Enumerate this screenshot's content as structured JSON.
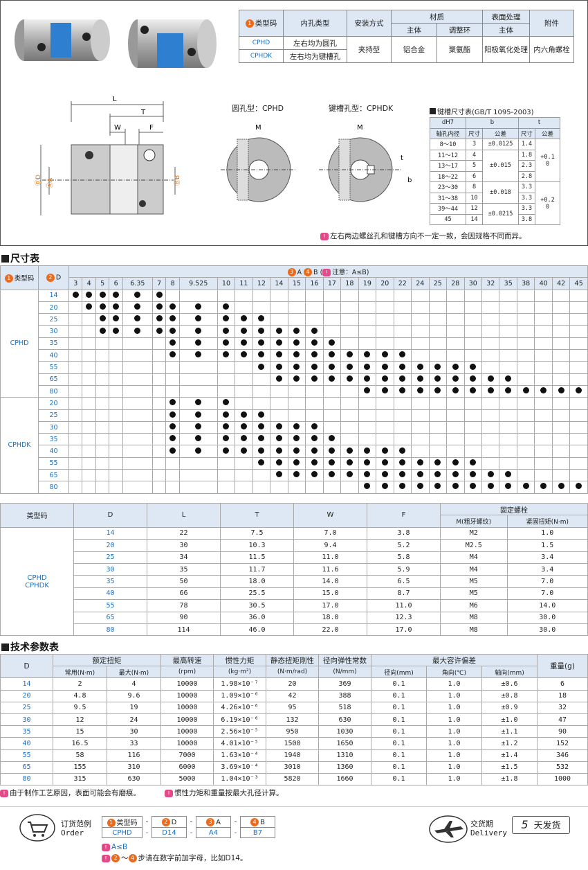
{
  "materials": {
    "headers": [
      "类型码",
      "内孔类型",
      "安装方式",
      "材质",
      "表面处理",
      "附件"
    ],
    "subheaders": [
      "主体",
      "调整环",
      "主体"
    ],
    "rows": [
      {
        "code": "CPHD",
        "hole": "左右均为圆孔"
      },
      {
        "code": "CPHDK",
        "hole": "左右均为键槽孔"
      }
    ],
    "mount": "夹持型",
    "body": "铝合金",
    "ring": "聚氨酯",
    "surface": "阳极氧化处理",
    "accessory": "内六角螺栓"
  },
  "drawing": {
    "round_title": "圆孔型：CPHD",
    "key_title": "键槽孔型：CPHDK",
    "L": "L",
    "T": "T",
    "W": "W",
    "F": "F",
    "M": "M",
    "t": "t",
    "b": "b",
    "D": "ⒹD",
    "A": "ⒶA",
    "B": "ⒷB"
  },
  "keyslot": {
    "title": "键槽尺寸表(GB/T 1095-2003)",
    "h1": "dH7",
    "h2": "轴孔内径",
    "b": "b",
    "t": "t",
    "size": "尺寸",
    "tol": "公差",
    "rows": [
      [
        "8～10",
        "3",
        "±0.0125",
        "1.4",
        "+0.1\n0"
      ],
      [
        "11～12",
        "4",
        "",
        "1.8",
        ""
      ],
      [
        "13～17",
        "5",
        "±0.015",
        "2.3",
        ""
      ],
      [
        "18～22",
        "6",
        "",
        "2.8",
        ""
      ],
      [
        "23～30",
        "8",
        "±0.018",
        "3.3",
        "+0.2\n0"
      ],
      [
        "31～38",
        "10",
        "",
        "3.3",
        ""
      ],
      [
        "39～44",
        "12",
        "±0.0215",
        "3.3",
        ""
      ],
      [
        "45",
        "14",
        "",
        "3.8",
        ""
      ]
    ]
  },
  "note_top": "左右两边螺丝孔和键槽方向不一定一致，会因规格不同而异。",
  "size_table": {
    "title": "尺寸表",
    "h_code": "类型码",
    "h_d": "D",
    "h_ab": "A",
    "h_b": "B",
    "h_note": "注意：A≤B",
    "cols": [
      "3",
      "4",
      "5",
      "6",
      "6.35",
      "7",
      "8",
      "9.525",
      "10",
      "11",
      "12",
      "14",
      "15",
      "16",
      "17",
      "18",
      "19",
      "20",
      "22",
      "24",
      "25",
      "28",
      "30",
      "32",
      "35",
      "38",
      "40",
      "42",
      "45"
    ],
    "groups": [
      {
        "code": "CPHD",
        "rows": [
          {
            "d": "14",
            "from": 0,
            "to": 5
          },
          {
            "d": "20",
            "from": 1,
            "to": 8
          },
          {
            "d": "25",
            "from": 2,
            "to": 10
          },
          {
            "d": "30",
            "from": 2,
            "to": 13
          },
          {
            "d": "35",
            "from": 6,
            "to": 14
          },
          {
            "d": "40",
            "from": 6,
            "to": 18
          },
          {
            "d": "55",
            "from": 10,
            "to": 22
          },
          {
            "d": "65",
            "from": 11,
            "to": 24
          },
          {
            "d": "80",
            "from": 16,
            "to": 28
          }
        ]
      },
      {
        "code": "CPHDK",
        "rows": [
          {
            "d": "20",
            "from": 6,
            "to": 8
          },
          {
            "d": "25",
            "from": 6,
            "to": 10
          },
          {
            "d": "30",
            "from": 6,
            "to": 13
          },
          {
            "d": "35",
            "from": 6,
            "to": 14
          },
          {
            "d": "40",
            "from": 6,
            "to": 18
          },
          {
            "d": "55",
            "from": 10,
            "to": 22
          },
          {
            "d": "65",
            "from": 11,
            "to": 24
          },
          {
            "d": "80",
            "from": 16,
            "to": 28
          }
        ]
      }
    ]
  },
  "dims": {
    "headers": [
      "类型码",
      "D",
      "L",
      "T",
      "W",
      "F",
      "固定螺栓"
    ],
    "sub": [
      "M(粗牙螺纹)",
      "紧固扭矩(N·m)"
    ],
    "codes": [
      "CPHD",
      "CPHDK"
    ],
    "rows": [
      [
        "14",
        "22",
        "7.5",
        "7.0",
        "3.8",
        "M2",
        "1.0"
      ],
      [
        "20",
        "30",
        "10.3",
        "9.4",
        "5.2",
        "M2.5",
        "1.5"
      ],
      [
        "25",
        "34",
        "11.5",
        "11.0",
        "5.8",
        "M4",
        "3.4"
      ],
      [
        "30",
        "35",
        "11.7",
        "11.6",
        "5.9",
        "M4",
        "3.4"
      ],
      [
        "35",
        "50",
        "18.0",
        "14.0",
        "6.5",
        "M5",
        "7.0"
      ],
      [
        "40",
        "66",
        "25.5",
        "15.0",
        "8.7",
        "M5",
        "7.0"
      ],
      [
        "55",
        "78",
        "30.5",
        "17.0",
        "11.0",
        "M6",
        "14.0"
      ],
      [
        "65",
        "90",
        "36.0",
        "18.0",
        "12.3",
        "M8",
        "30.0"
      ],
      [
        "80",
        "114",
        "46.0",
        "22.0",
        "17.0",
        "M8",
        "30.0"
      ]
    ]
  },
  "tech": {
    "title": "技术参数表",
    "headers": [
      "D",
      "额定扭矩",
      "最高转速",
      "惯性力矩",
      "静态扭矩刚性",
      "径向弹性常数",
      "最大容许偏差",
      "重量(g)"
    ],
    "sub": [
      "常用(N·m)",
      "最大(N·m)",
      "(rpm)",
      "(kg·m²)",
      "(N·m/rad)",
      "(N/mm)",
      "径向(mm)",
      "角向(℃)",
      "轴向(mm)"
    ],
    "rows": [
      [
        "14",
        "2",
        "4",
        "10000",
        "1.98×10⁻⁷",
        "20",
        "369",
        "0.1",
        "1.0",
        "±0.6",
        "6"
      ],
      [
        "20",
        "4.8",
        "9.6",
        "10000",
        "1.09×10⁻⁶",
        "42",
        "388",
        "0.1",
        "1.0",
        "±0.8",
        "18"
      ],
      [
        "25",
        "9.5",
        "19",
        "10000",
        "4.26×10⁻⁶",
        "95",
        "518",
        "0.1",
        "1.0",
        "±0.9",
        "32"
      ],
      [
        "30",
        "12",
        "24",
        "10000",
        "6.19×10⁻⁶",
        "132",
        "630",
        "0.1",
        "1.0",
        "±1.0",
        "47"
      ],
      [
        "35",
        "15",
        "30",
        "10000",
        "2.56×10⁻⁵",
        "950",
        "1030",
        "0.1",
        "1.0",
        "±1.1",
        "90"
      ],
      [
        "40",
        "16.5",
        "33",
        "10000",
        "4.01×10⁻⁵",
        "1500",
        "1650",
        "0.1",
        "1.0",
        "±1.2",
        "152"
      ],
      [
        "55",
        "58",
        "116",
        "7000",
        "1.63×10⁻⁴",
        "1940",
        "1310",
        "0.1",
        "1.0",
        "±1.4",
        "346"
      ],
      [
        "65",
        "155",
        "310",
        "6000",
        "3.69×10⁻⁴",
        "3010",
        "1360",
        "0.1",
        "1.0",
        "±1.5",
        "532"
      ],
      [
        "80",
        "315",
        "630",
        "5000",
        "1.04×10⁻³",
        "5820",
        "1660",
        "0.1",
        "1.0",
        "±1.8",
        "1000"
      ]
    ]
  },
  "notes": {
    "n1": "由于制作工艺原因，表面可能会有磨痕。",
    "n2": "惯性力矩和重量按最大孔径计算。"
  },
  "order": {
    "label": "订货范例",
    "label_en": "Order",
    "heads": [
      "类型码",
      "D",
      "A",
      "B"
    ],
    "vals": [
      "CPHD",
      "D14",
      "A4",
      "B7"
    ],
    "sep": "-",
    "note1": "A≤B",
    "note2": "～",
    "note2b": "步请在数字前加字母，比如D14。",
    "delivery": "交货期",
    "delivery_en": "Delivery",
    "days": "5",
    "days_label": "天发货"
  }
}
